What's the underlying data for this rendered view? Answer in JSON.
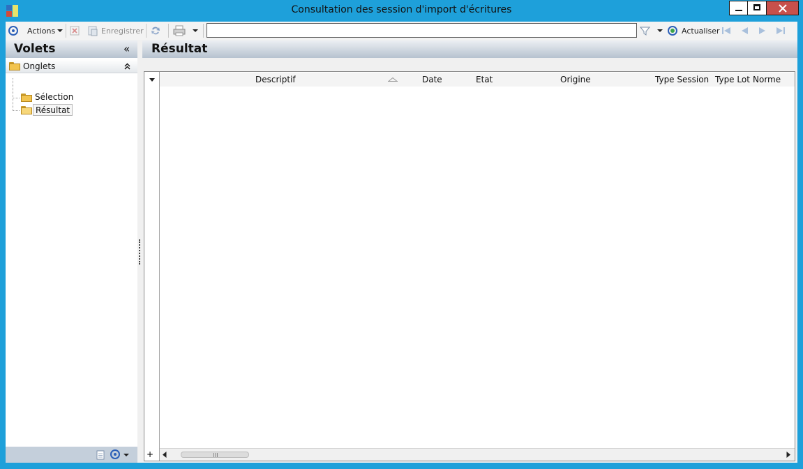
{
  "window": {
    "title": "Consultation des session d'import d'écritures"
  },
  "toolbar": {
    "actions_label": "Actions",
    "save_label": "Enregistrer",
    "search_value": "",
    "refresh_label": "Actualiser"
  },
  "left_pane": {
    "title": "Volets",
    "collapse_glyph": "«",
    "group": {
      "label": "Onglets",
      "items": [
        {
          "label": "Sélection"
        },
        {
          "label": "Résultat",
          "selected": true
        }
      ]
    }
  },
  "right_pane": {
    "title": "Résultat"
  },
  "grid": {
    "columns": [
      {
        "label": "Descriptif"
      },
      {
        "label": "Date"
      },
      {
        "label": "Etat"
      },
      {
        "label": "Origine"
      },
      {
        "label": "Type Session"
      },
      {
        "label": "Type Lot"
      },
      {
        "label": "Norme"
      }
    ],
    "rows": []
  },
  "colors": {
    "window_frame": "#1ea0da",
    "close_button": "#c7504b",
    "pane_header_gradient_bottom": "#b6c2cf",
    "accent_icon": "#2b5fb8"
  },
  "icons": {
    "app": "app-logo-icon",
    "actions": "target-icon",
    "delete": "delete-icon",
    "save": "save-icon",
    "sync": "sync-icon",
    "print": "printer-icon",
    "filter": "filter-icon",
    "refresh": "refresh-icon",
    "nav_first": "first-record-icon",
    "nav_prev": "previous-record-icon",
    "nav_next": "next-record-icon",
    "nav_last": "last-record-icon",
    "folder": "folder-icon"
  }
}
